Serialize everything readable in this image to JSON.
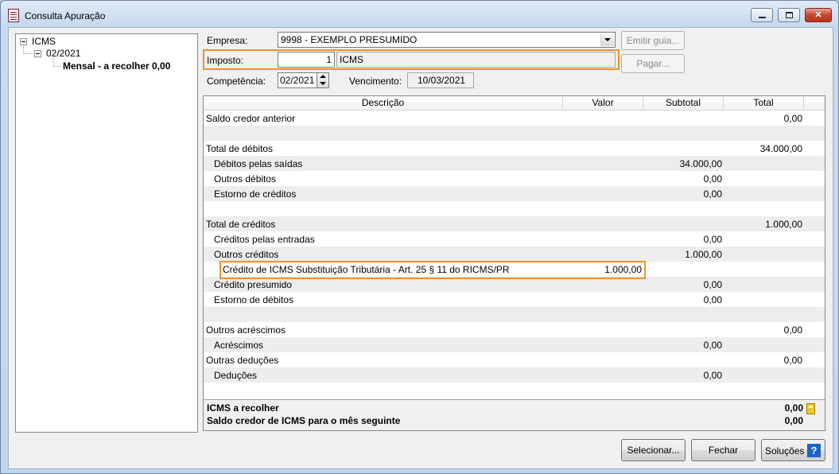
{
  "window": {
    "title": "Consulta Apuração",
    "controls": [
      "minimize-icon",
      "maximize-icon",
      "close-icon"
    ]
  },
  "tree": {
    "root": "ICMS",
    "child": "02/2021",
    "leaf": "Mensal - a recolher 0,00"
  },
  "form": {
    "empresa_label": "Empresa:",
    "empresa_value": "9998 - EXEMPLO PRESUMIDO",
    "imposto_label": "Imposto:",
    "imposto_code": "1",
    "imposto_name": "ICMS",
    "competencia_label": "Competência:",
    "competencia_value": "02/2021",
    "vencimento_label": "Vencimento:",
    "vencimento_value": "10/03/2021",
    "emitir_guia": "Emitir guia...",
    "pagar": "Pagar..."
  },
  "grid": {
    "headers": [
      "Descrição",
      "Valor",
      "Subtotal",
      "Total"
    ],
    "rows": [
      {
        "desc": "Saldo credor anterior",
        "indent": 0,
        "valor": "",
        "subtotal": "",
        "total": "0,00"
      },
      {
        "desc": "",
        "indent": 0,
        "valor": "",
        "subtotal": "",
        "total": ""
      },
      {
        "desc": "Total de débitos",
        "indent": 0,
        "valor": "",
        "subtotal": "",
        "total": "34.000,00"
      },
      {
        "desc": "Débitos pelas saídas",
        "indent": 1,
        "valor": "",
        "subtotal": "34.000,00",
        "total": ""
      },
      {
        "desc": "Outros débitos",
        "indent": 1,
        "valor": "",
        "subtotal": "0,00",
        "total": ""
      },
      {
        "desc": "Estorno de créditos",
        "indent": 1,
        "valor": "",
        "subtotal": "0,00",
        "total": ""
      },
      {
        "desc": "",
        "indent": 0,
        "valor": "",
        "subtotal": "",
        "total": ""
      },
      {
        "desc": "Total de créditos",
        "indent": 0,
        "valor": "",
        "subtotal": "",
        "total": "1.000,00"
      },
      {
        "desc": "Créditos pelas entradas",
        "indent": 1,
        "valor": "",
        "subtotal": "0,00",
        "total": ""
      },
      {
        "desc": "Outros créditos",
        "indent": 1,
        "valor": "",
        "subtotal": "1.000,00",
        "total": ""
      },
      {
        "desc": "Crédito de ICMS Substituição Tributária - Art. 25 § 11 do RICMS/PR",
        "indent": 2,
        "valor": "1.000,00",
        "subtotal": "",
        "total": ""
      },
      {
        "desc": "Crédito presumido",
        "indent": 1,
        "valor": "",
        "subtotal": "0,00",
        "total": ""
      },
      {
        "desc": "Estorno de débitos",
        "indent": 1,
        "valor": "",
        "subtotal": "0,00",
        "total": ""
      },
      {
        "desc": "",
        "indent": 0,
        "valor": "",
        "subtotal": "",
        "total": ""
      },
      {
        "desc": "Outros acréscimos",
        "indent": 0,
        "valor": "",
        "subtotal": "",
        "total": "0,00"
      },
      {
        "desc": "Acréscimos",
        "indent": 1,
        "valor": "",
        "subtotal": "0,00",
        "total": ""
      },
      {
        "desc": "Outras deduções",
        "indent": 0,
        "valor": "",
        "subtotal": "",
        "total": "0,00"
      },
      {
        "desc": "Deduções",
        "indent": 1,
        "valor": "",
        "subtotal": "0,00",
        "total": ""
      }
    ],
    "footer": {
      "recolher_label": "ICMS a recolher",
      "recolher_value": "0,00",
      "saldo_label": "Saldo credor de ICMS para o mês seguinte",
      "saldo_value": "0,00"
    }
  },
  "buttons": {
    "selecionar": "Selecionar...",
    "fechar": "Fechar",
    "solucoes": "Soluções",
    "help_glyph": "?"
  },
  "colors": {
    "highlight": "#f0922b",
    "help": "#1c64c8"
  }
}
